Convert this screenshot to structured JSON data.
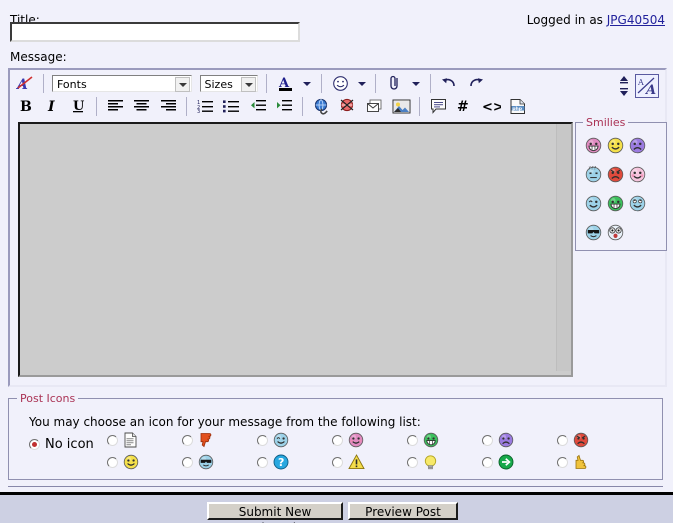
{
  "header": {
    "title_label": "Title:",
    "title_value": "",
    "title_placeholder": "",
    "login_prefix": "Logged in as ",
    "login_user": "JPG40504",
    "message_label": "Message:"
  },
  "toolbar": {
    "row1": [
      {
        "name": "remove-formatting-icon",
        "icon": "remove-format",
        "label": "Remove Formatting"
      },
      {
        "name": "fonts-select",
        "icon": "combo",
        "label": "Fonts",
        "width": 140
      },
      {
        "name": "sizes-select",
        "icon": "combo",
        "label": "Sizes",
        "width": 58
      },
      {
        "name": "font-color-button",
        "icon": "font-color",
        "label": "Font Color"
      },
      {
        "name": "smilie-button",
        "icon": "smilie",
        "label": "Insert Smilie"
      },
      {
        "name": "attachment-button",
        "icon": "paperclip",
        "label": "Attachment"
      },
      {
        "name": "undo-button",
        "icon": "undo",
        "label": "Undo"
      },
      {
        "name": "redo-button",
        "icon": "redo",
        "label": "Redo"
      }
    ],
    "row2": [
      {
        "name": "bold-button",
        "icon": "bold",
        "label": "B"
      },
      {
        "name": "italic-button",
        "icon": "italic",
        "label": "I"
      },
      {
        "name": "underline-button",
        "icon": "underline",
        "label": "U"
      },
      {
        "name": "align-left-button",
        "icon": "align-left",
        "label": "Align Left"
      },
      {
        "name": "align-center-button",
        "icon": "align-center",
        "label": "Align Center"
      },
      {
        "name": "align-right-button",
        "icon": "align-right",
        "label": "Align Right"
      },
      {
        "name": "ordered-list-button",
        "icon": "ordered-list",
        "label": "Ordered List"
      },
      {
        "name": "unordered-list-button",
        "icon": "unordered-list",
        "label": "Unordered List"
      },
      {
        "name": "outdent-button",
        "icon": "outdent",
        "label": "Decrease Indent"
      },
      {
        "name": "indent-button",
        "icon": "indent",
        "label": "Increase Indent"
      },
      {
        "name": "insert-link-button",
        "icon": "globe-link",
        "label": "Insert Link"
      },
      {
        "name": "remove-link-button",
        "icon": "broken-link",
        "label": "Remove Link"
      },
      {
        "name": "insert-email-button",
        "icon": "email",
        "label": "Insert Email Link"
      },
      {
        "name": "insert-image-button",
        "icon": "image",
        "label": "Insert Image"
      },
      {
        "name": "quote-button",
        "icon": "quote",
        "label": "Wrap in Quote Tags"
      },
      {
        "name": "code-hash-button",
        "icon": "hash",
        "label": "Wrap in CODE Tags"
      },
      {
        "name": "html-button",
        "icon": "angle-brackets",
        "label": "Wrap in HTML Tags"
      },
      {
        "name": "php-button",
        "icon": "php",
        "label": "Wrap in PHP Tags"
      }
    ],
    "resize_up_label": "Increase Editor Size",
    "resize_down_label": "Decrease Editor Size",
    "toggle_editor_label": "Toggle Editor Mode"
  },
  "message": {
    "value": ""
  },
  "smilies": {
    "legend": "Smilies",
    "items": [
      {
        "name": "smilie-big-grin",
        "face": "grin",
        "color": "#e08ac0"
      },
      {
        "name": "smilie-smile",
        "face": "smile",
        "color": "#f4e04a"
      },
      {
        "name": "smilie-frown",
        "face": "frown",
        "color": "#9b7be0"
      },
      {
        "name": "smilie-confused",
        "face": "confused",
        "color": "#9dd2e8"
      },
      {
        "name": "smilie-mad",
        "face": "mad",
        "color": "#e04a3c"
      },
      {
        "name": "smilie-redface",
        "face": "blush",
        "color": "#f6c4dd"
      },
      {
        "name": "smilie-wink",
        "face": "wink",
        "color": "#9dd2e8"
      },
      {
        "name": "smilie-biggrin",
        "face": "teeth",
        "color": "#3cbf5c"
      },
      {
        "name": "smilie-rolleyes",
        "face": "roll",
        "color": "#9dd2e8"
      },
      {
        "name": "smilie-cool",
        "face": "cool",
        "color": "#9dd2e8"
      },
      {
        "name": "smilie-eek",
        "face": "eek",
        "color": "#e8f0f8"
      }
    ]
  },
  "post_icons": {
    "legend": "Post Icons",
    "help_text": "You may choose an icon for your message from the following list:",
    "no_icon_label": "No icon",
    "no_icon_selected": true,
    "columns": [
      [
        {
          "name": "post-icon-post",
          "icon": "document",
          "selected": false
        },
        {
          "name": "post-icon-smile",
          "icon": "smile",
          "selected": false
        }
      ],
      [
        {
          "name": "post-icon-thumbsdown",
          "icon": "thumbs-down",
          "selected": false
        },
        {
          "name": "post-icon-cool",
          "icon": "cool",
          "selected": false
        }
      ],
      [
        {
          "name": "post-icon-wink",
          "icon": "wink",
          "selected": false
        },
        {
          "name": "post-icon-question",
          "icon": "question",
          "selected": false
        }
      ],
      [
        {
          "name": "post-icon-redface",
          "icon": "blush",
          "selected": false
        },
        {
          "name": "post-icon-exclaim",
          "icon": "warning",
          "selected": false
        }
      ],
      [
        {
          "name": "post-icon-biggrin",
          "icon": "teeth",
          "selected": false
        },
        {
          "name": "post-icon-idea",
          "icon": "lightbulb",
          "selected": false
        }
      ],
      [
        {
          "name": "post-icon-frown",
          "icon": "frown",
          "selected": false
        },
        {
          "name": "post-icon-arrow",
          "icon": "green-arrow",
          "selected": false
        }
      ],
      [
        {
          "name": "post-icon-mad",
          "icon": "mad",
          "selected": false
        },
        {
          "name": "post-icon-thumbsup",
          "icon": "thumbs-up",
          "selected": false
        }
      ]
    ]
  },
  "footer": {
    "submit_label": "Submit New Thread",
    "preview_label": "Preview Post"
  },
  "colors": {
    "page_bg": "#f1f1fb",
    "editor_bg": "#cccccc",
    "footer_bg": "#cdd0e3",
    "legend_text": "#aa3355",
    "link": "#22229c"
  }
}
